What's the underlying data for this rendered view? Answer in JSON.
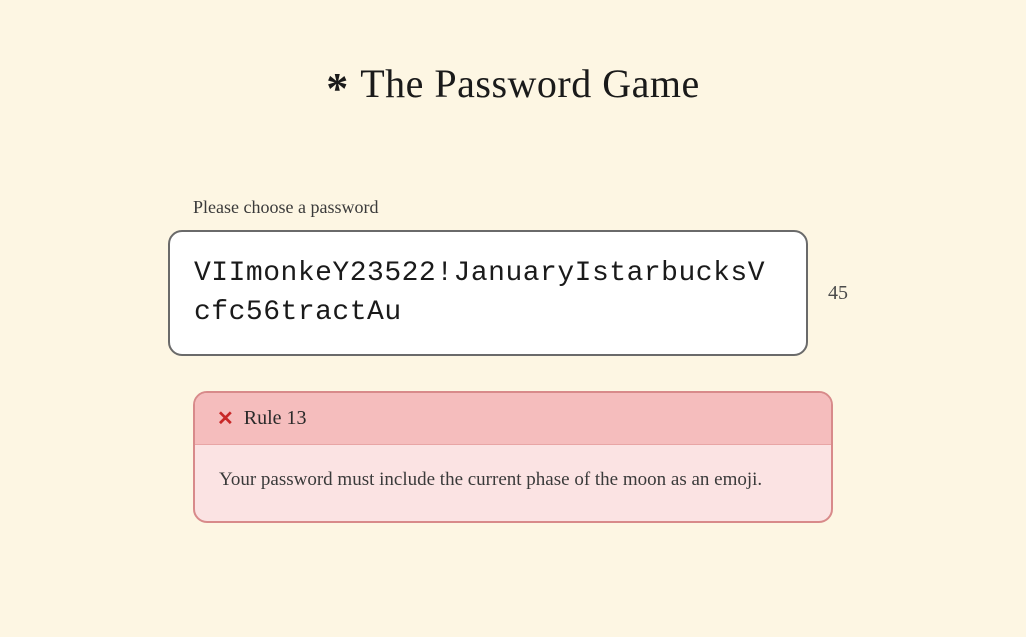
{
  "header": {
    "asterisk": "*",
    "title": "The Password Game"
  },
  "prompt": {
    "label": "Please choose a password"
  },
  "password": {
    "value": "VIImonkeY23522!JanuaryIstarbucksVcfc56tractAu",
    "char_count": "45"
  },
  "rule": {
    "icon": "✕",
    "title": "Rule 13",
    "text": "Your password must include the current phase of the moon as an emoji."
  }
}
